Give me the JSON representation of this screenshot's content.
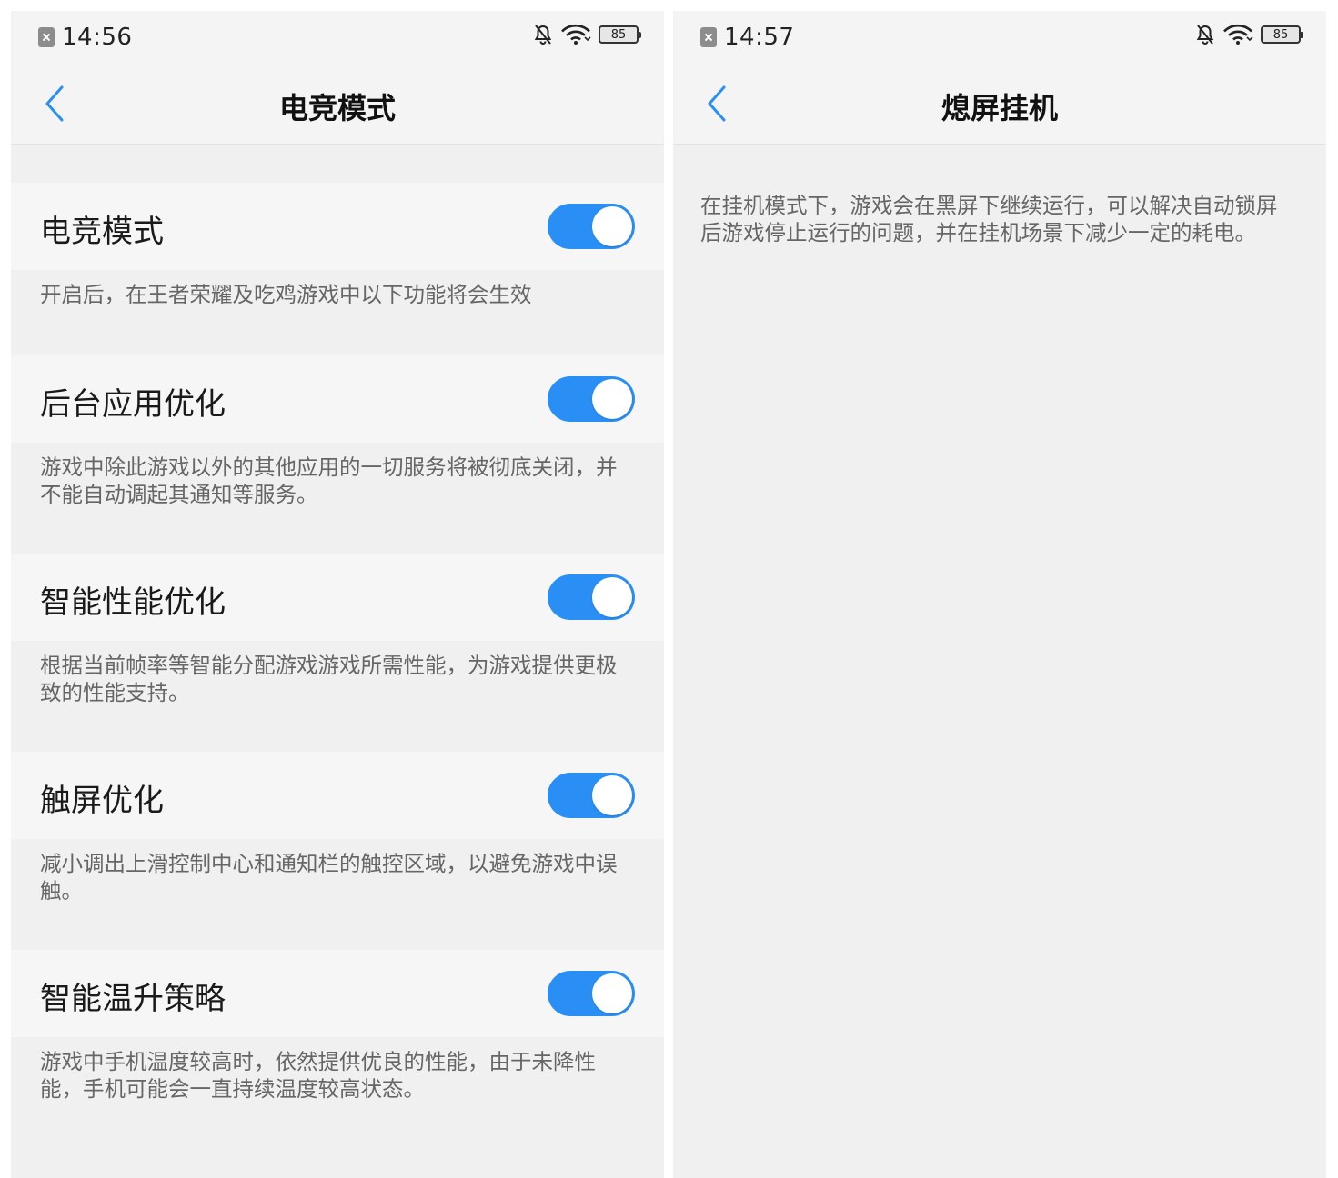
{
  "left": {
    "status": {
      "time": "14:56",
      "battery": "85"
    },
    "title": "电竞模式",
    "settings": [
      {
        "label": "电竞模式",
        "enabled": true,
        "description": "开启后，在王者荣耀及吃鸡游戏中以下功能将会生效"
      },
      {
        "label": "后台应用优化",
        "enabled": true,
        "description": "游戏中除此游戏以外的其他应用的一切服务将被彻底关闭，并不能自动调起其通知等服务。"
      },
      {
        "label": "智能性能优化",
        "enabled": true,
        "description": "根据当前帧率等智能分配游戏游戏所需性能，为游戏提供更极致的性能支持。"
      },
      {
        "label": "触屏优化",
        "enabled": true,
        "description": "减小调出上滑控制中心和通知栏的触控区域，以避免游戏中误触。"
      },
      {
        "label": "智能温升策略",
        "enabled": true,
        "description": "游戏中手机温度较高时，依然提供优良的性能，由于未降性能，手机可能会一直持续温度较高状态。"
      }
    ]
  },
  "right": {
    "status": {
      "time": "14:57",
      "battery": "85"
    },
    "title": "熄屏挂机",
    "description": "在挂机模式下，游戏会在黑屏下继续运行，可以解决自动锁屏后游戏停止运行的问题，并在挂机场景下减少一定的耗电。"
  },
  "colors": {
    "accent": "#2a8ff5",
    "background": "#f0f0f0"
  },
  "icons": {
    "sim": "sim-card-error-icon",
    "mute": "bell-off-icon",
    "wifi": "wifi-icon",
    "battery": "battery-icon",
    "back": "chevron-left-icon"
  }
}
